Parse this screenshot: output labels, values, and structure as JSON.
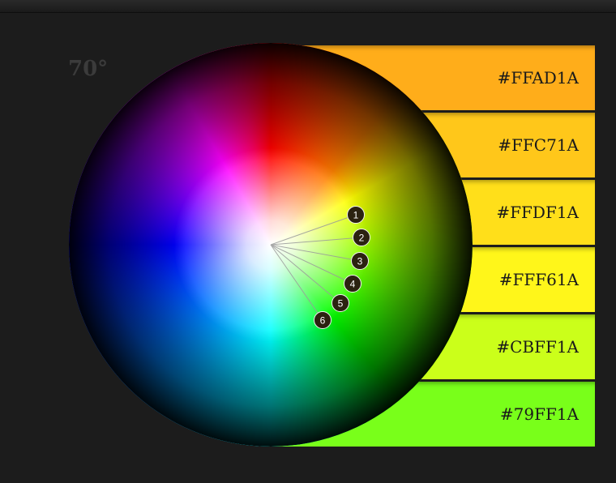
{
  "angle_label": "70°",
  "swatches": [
    {
      "hex": "#FFAD1A",
      "color": "#FFAD1A"
    },
    {
      "hex": "#FFC71A",
      "color": "#FFC71A"
    },
    {
      "hex": "#FFDF1A",
      "color": "#FFDF1A"
    },
    {
      "hex": "#FFF61A",
      "color": "#FFF61A"
    },
    {
      "hex": "#CBFF1A",
      "color": "#CBFF1A"
    },
    {
      "hex": "#79FF1A",
      "color": "#79FF1A"
    }
  ],
  "markers": [
    {
      "number": "1"
    },
    {
      "number": "2"
    },
    {
      "number": "3"
    },
    {
      "number": "4"
    },
    {
      "number": "5"
    },
    {
      "number": "6"
    }
  ]
}
